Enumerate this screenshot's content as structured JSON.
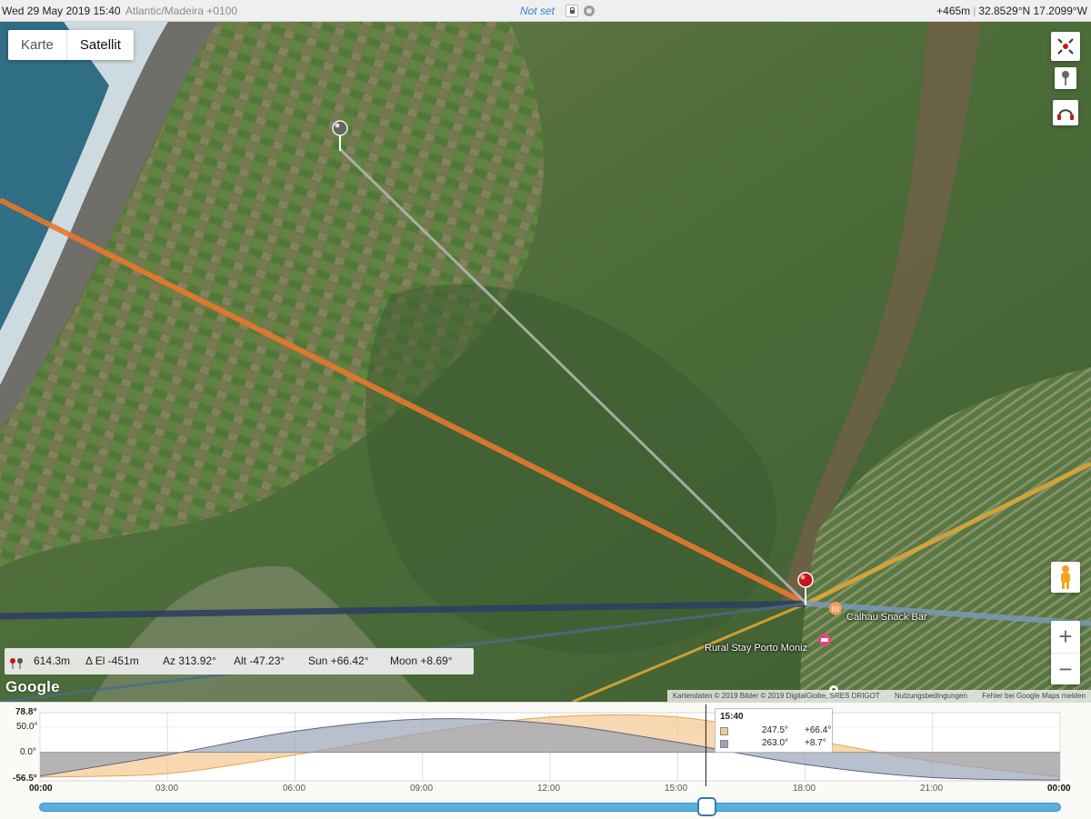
{
  "topbar": {
    "datetime": "Wed 29 May 2019 15:40",
    "timezone": "Atlantic/Madeira +0100",
    "status": "Not set",
    "elevation": "+465m",
    "coordinates": "32.8529°N 17.2099°W",
    "separator": "|"
  },
  "map": {
    "map_types": [
      "Karte",
      "Satellit"
    ],
    "selected_map_type": "Satellit",
    "right_controls": [
      "fullscreen-markers-icon",
      "pin-icon",
      "headphones-icon"
    ],
    "pegman": "pegman-icon",
    "zoom_in": "+",
    "zoom_out": "−",
    "logo": "Google",
    "pois": [
      {
        "label": "Calhau Snack Bar",
        "icon": "restaurant-icon"
      },
      {
        "label": "Rural Stay Porto Moniz",
        "icon": "hotel-icon"
      }
    ],
    "attribution": {
      "data": "Kartendaten © 2019 Bilder © 2019 DigitalGlobe, SRES DRIGOT",
      "terms": "Nutzungsbedingungen",
      "report": "Fehler bei Google Maps melden"
    },
    "info": {
      "distance": "614.3m",
      "delta_el": "Δ El  -451m",
      "azimuth": "Az 313.92°",
      "altitude": "Alt  -47.23°",
      "sun": "Sun +66.42°",
      "moon": "Moon +8.69°"
    },
    "colors": {
      "sun_line": "#e8782d",
      "sun_rise_line": "#e7a934",
      "moon_line": "#2f3f61",
      "moon_set_line": "#4c6b8c"
    }
  },
  "chart": {
    "y_labels": [
      "78.8°",
      "50.0°",
      "0.0°",
      "-56.5°"
    ],
    "x_labels": [
      "00:00",
      "03:00",
      "06:00",
      "09:00",
      "12:00",
      "15:00",
      "18:00",
      "21:00",
      "00:00"
    ],
    "tooltip": {
      "time": "15:40",
      "sun": {
        "azimuth": "247.5°",
        "altitude": "+66.4°"
      },
      "moon": {
        "azimuth": "263.0°",
        "altitude": "+8.7°"
      }
    },
    "colors": {
      "sun": "#f5c88e",
      "moon": "#9aa4b8"
    }
  },
  "chart_data": {
    "type": "area",
    "x": [
      "00:00",
      "03:00",
      "06:00",
      "09:00",
      "12:00",
      "15:00",
      "18:00",
      "21:00",
      "24:00"
    ],
    "ylim": [
      -56.5,
      78.8
    ],
    "series": [
      {
        "name": "Sun",
        "values": [
          -49,
          -42,
          -5,
          38,
          70,
          70,
          27,
          -18,
          -49
        ]
      },
      {
        "name": "Moon",
        "values": [
          -47,
          -5,
          42,
          66,
          57,
          20,
          -24,
          -50,
          -55
        ]
      }
    ],
    "current_time": "15:40"
  }
}
